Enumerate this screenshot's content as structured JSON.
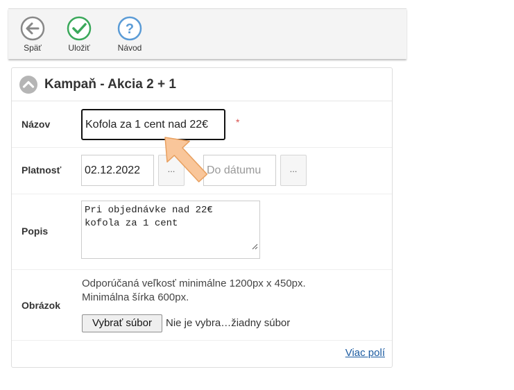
{
  "toolbar": {
    "back_label": "Späť",
    "save_label": "Uložiť",
    "help_label": "Návod"
  },
  "panel": {
    "title": "Kampaň - Akcia 2 + 1"
  },
  "form": {
    "name": {
      "label": "Názov",
      "value": "Kofola za 1 cent nad 22€",
      "required_mark": "*"
    },
    "validity": {
      "label": "Platnosť",
      "from_value": "02.12.2022",
      "to_placeholder": "Do dátumu",
      "picker_label": "..."
    },
    "description": {
      "label": "Popis",
      "value": "Pri objednávke nad 22€\nkofola za 1 cent"
    },
    "image": {
      "label": "Obrázok",
      "hint_line1": "Odporúčaná veľkosť minimálne 1200px x 450px.",
      "hint_line2": "Minimálna šírka 600px.",
      "choose_button": "Vybrať súbor",
      "file_status": "Nie je vybra…žiadny súbor"
    },
    "more_fields": "Viac polí"
  },
  "colors": {
    "back_icon": "#888888",
    "save_icon": "#3aa85a",
    "help_icon": "#5a9bd6",
    "required": "#d9534f",
    "link": "#1a5aa0",
    "arrow": "#f9c69a"
  }
}
